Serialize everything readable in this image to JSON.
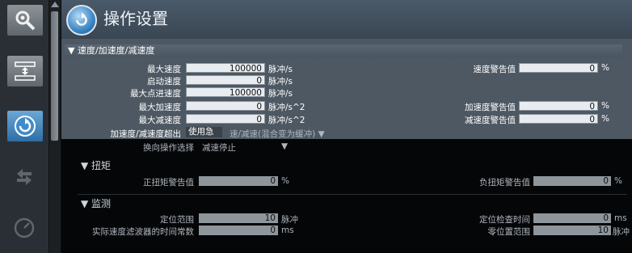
{
  "header": {
    "title": "操作设置"
  },
  "section_speed": {
    "title": "▼ 速度/加速度/减速度",
    "rows": [
      {
        "label": "最大速度",
        "value": "100000",
        "unit": "脉冲/s"
      },
      {
        "label": "启动速度",
        "value": "0",
        "unit": "脉冲/s"
      },
      {
        "label": "最大点进速度",
        "value": "100000",
        "unit": "脉冲/s"
      },
      {
        "label": "最大加速度",
        "value": "0",
        "unit": "脉冲/s^2"
      },
      {
        "label": "最大减速度",
        "value": "0",
        "unit": "脉冲/s^2"
      }
    ],
    "warnings": [
      {
        "label": "速度警告值",
        "value": "0",
        "unit": "%"
      },
      {
        "label": "加速度警告值",
        "value": "0",
        "unit": "%"
      },
      {
        "label": "减速度警告值",
        "value": "0",
        "unit": "%"
      }
    ],
    "overflow_label": "加速度/减速度超出",
    "overflow_value": "使用急",
    "overflow_tail": "速/减速(混合变为缓冲) ▼",
    "reverse_label": "换向操作选择",
    "reverse_value": "减速停止"
  },
  "section_torque": {
    "title": "▼ 扭矩",
    "pos_label": "正扭矩警告值",
    "pos_value": "0",
    "pos_unit": "%",
    "neg_label": "负扭矩警告值",
    "neg_value": "0",
    "neg_unit": "%"
  },
  "section_monitor": {
    "title": "▼ 监测",
    "pos_range_label": "定位范围",
    "pos_range_value": "10",
    "pos_range_unit": "脉冲",
    "filter_label": "实际速度滤波器的时间常数",
    "filter_value": "0",
    "filter_unit": "ms",
    "check_time_label": "定位检查时间",
    "check_time_value": "0",
    "check_time_unit": "ms",
    "zero_range_label": "零位置范围",
    "zero_range_value": "10",
    "zero_range_unit": "脉冲"
  }
}
